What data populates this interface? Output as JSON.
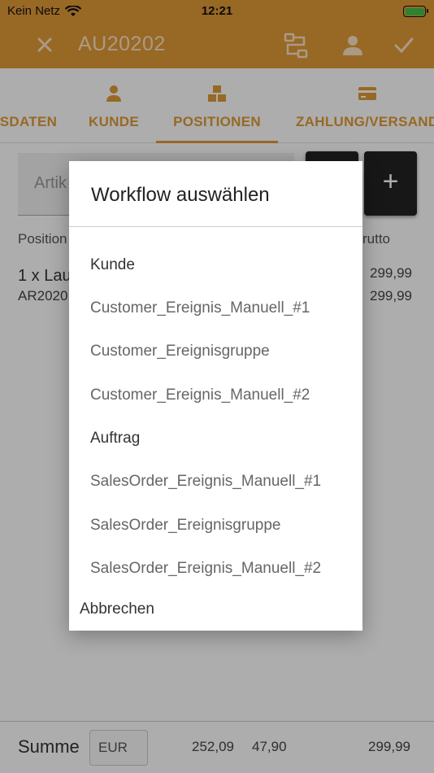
{
  "status": {
    "carrier": "Kein Netz",
    "time": "12:21"
  },
  "appbar": {
    "title": "AU20202",
    "close_icon": "close-icon",
    "workflow_icon": "workflow-icon",
    "user_icon": "user-icon",
    "confirm_icon": "check-icon",
    "color": "#e19a37"
  },
  "tabs": [
    {
      "label": "SDATEN",
      "icon": ""
    },
    {
      "label": "KUNDE",
      "icon": "person-icon"
    },
    {
      "label": "POSITIONEN",
      "icon": "boxes-icon"
    },
    {
      "label": "ZAHLUNG/VERSAND",
      "icon": "credit-card-icon"
    }
  ],
  "main": {
    "search_placeholder": "Artik",
    "add_label": "+",
    "col_position": "Position",
    "col_brutto": "rutto",
    "item_line": "1 x Lau",
    "item_number": "AR2020",
    "item_price": "299,99",
    "item_price2": "299,99"
  },
  "footer": {
    "sum_label": "Summe",
    "currency": "EUR",
    "net": "252,09",
    "tax": "47,90",
    "gross": "299,99"
  },
  "dialog": {
    "title": "Workflow auswählen",
    "options": [
      {
        "label": "Kunde",
        "type": "group"
      },
      {
        "label": "Customer_Ereignis_Manuell_#1",
        "type": "item"
      },
      {
        "label": "Customer_Ereignisgruppe",
        "type": "item"
      },
      {
        "label": "Customer_Ereignis_Manuell_#2",
        "type": "item"
      },
      {
        "label": "Auftrag",
        "type": "group"
      },
      {
        "label": "SalesOrder_Ereignis_Manuell_#1",
        "type": "item"
      },
      {
        "label": "SalesOrder_Ereignisgruppe",
        "type": "item"
      },
      {
        "label": "SalesOrder_Ereignis_Manuell_#2",
        "type": "item"
      }
    ],
    "cancel": "Abbrechen"
  }
}
